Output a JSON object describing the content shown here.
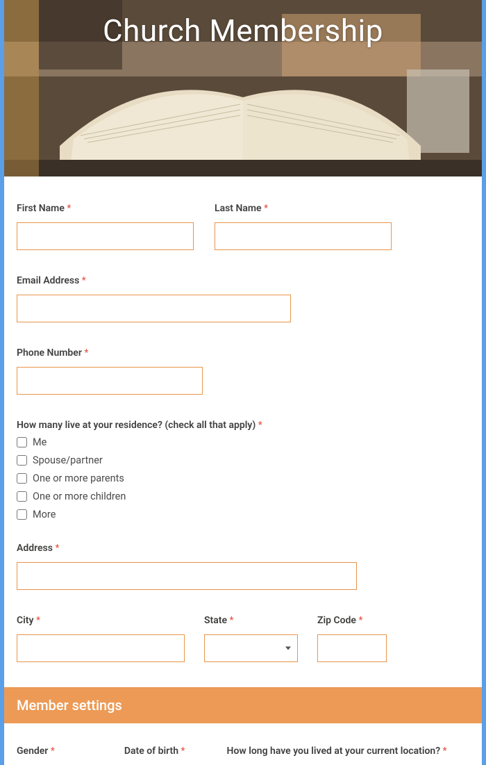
{
  "hero": {
    "title": "Church Membership"
  },
  "labels": {
    "firstName": "First Name",
    "lastName": "Last Name",
    "email": "Email Address",
    "phone": "Phone Number",
    "residence": "How many live at your residence? (check all that apply)",
    "address": "Address",
    "city": "City",
    "state": "State",
    "zip": "Zip Code",
    "gender": "Gender",
    "dob": "Date of birth",
    "howLong": "How long have you lived at your current location?"
  },
  "residenceOptions": [
    "Me",
    "Spouse/partner",
    "One or more parents",
    "One or more children",
    "More"
  ],
  "sectionHeader": "Member settings",
  "requiredMark": "*"
}
